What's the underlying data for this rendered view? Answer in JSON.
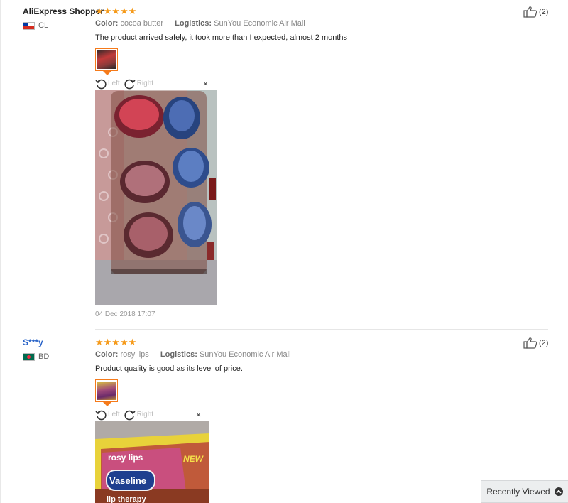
{
  "reviews": [
    {
      "user": "AliExpress Shopper",
      "country": "CL",
      "stars": "★★★★★",
      "color_label": "Color:",
      "color_value": "cocoa butter",
      "logistics_label": "Logistics:",
      "logistics_value": "SunYou Economic Air Mail",
      "text": "The product arrived safely, it took more than I expected, almost 2 months",
      "rotate_left": "Left",
      "rotate_right": "Right",
      "close": "×",
      "date": "04 Dec 2018 17:07",
      "likes": "(2)"
    },
    {
      "user": "S***y",
      "country": "BD",
      "stars": "★★★★★",
      "color_label": "Color:",
      "color_value": "rosy lips",
      "logistics_label": "Logistics:",
      "logistics_value": "SunYou Economic Air Mail",
      "text": "Product quality is good as its level of price.",
      "rotate_left": "Left",
      "rotate_right": "Right",
      "close": "×",
      "likes": "(2)",
      "photo_text_1": "rosy lips",
      "photo_text_2": "NEW",
      "photo_text_3": "Vaseline",
      "photo_text_4": "lip therapy"
    }
  ],
  "recently_viewed": "Recently Viewed",
  "colors": {
    "star": "#f59a1a",
    "accent": "#f57a1a",
    "link": "#2a64c8"
  }
}
